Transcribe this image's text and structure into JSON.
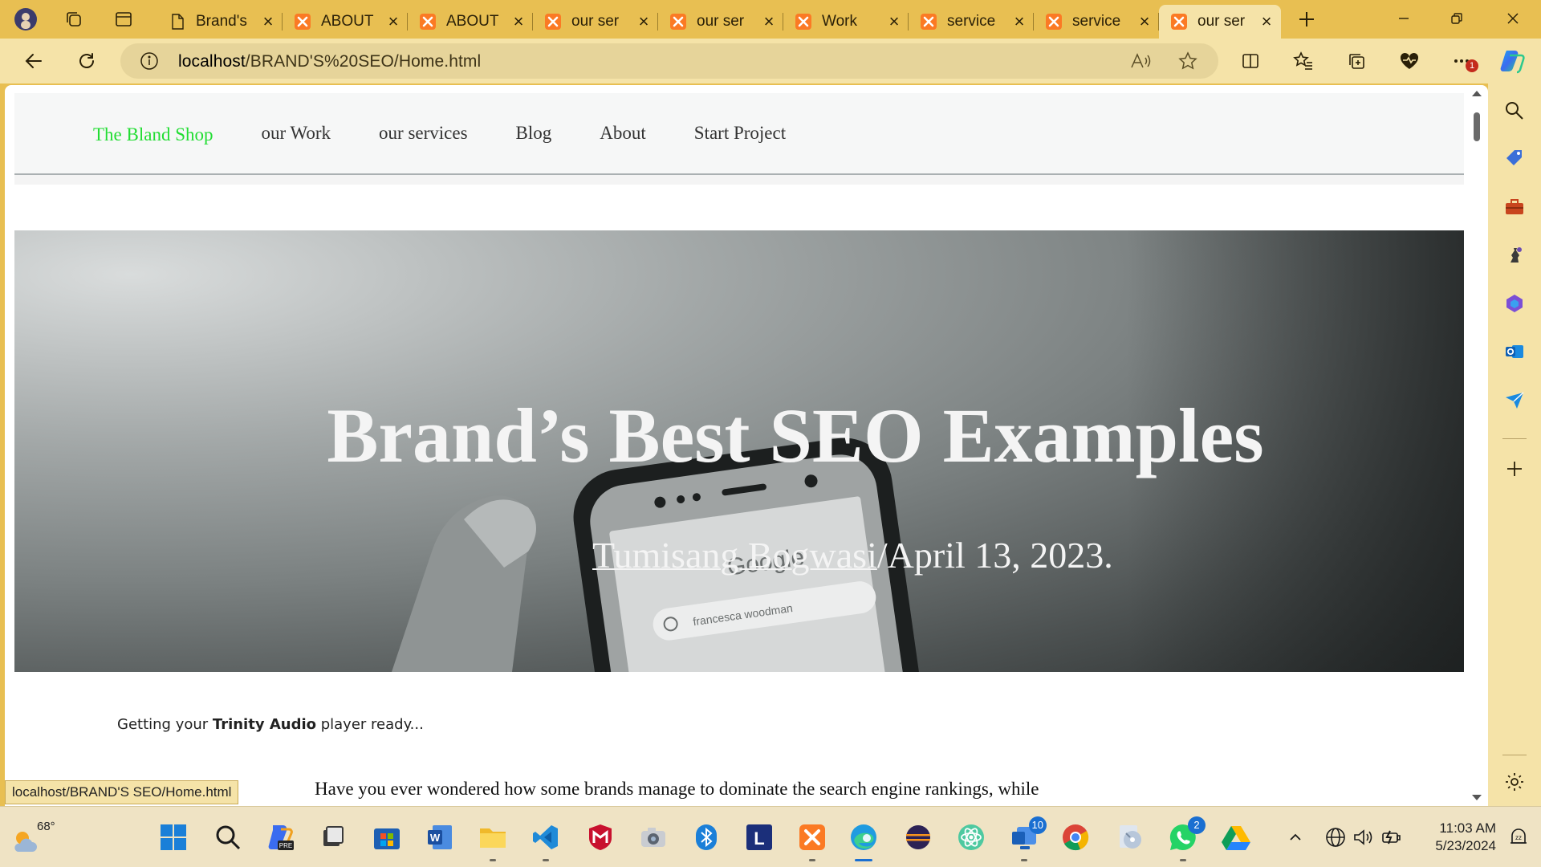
{
  "browser": {
    "tabs": [
      {
        "title": "Brand's",
        "icon": "document-icon",
        "active": false
      },
      {
        "title": "ABOUT",
        "icon": "xampp-icon",
        "active": false
      },
      {
        "title": "ABOUT",
        "icon": "xampp-icon",
        "active": false
      },
      {
        "title": "our ser",
        "icon": "xampp-icon",
        "active": false
      },
      {
        "title": "our ser",
        "icon": "xampp-icon",
        "active": false
      },
      {
        "title": "Work",
        "icon": "xampp-icon",
        "active": false
      },
      {
        "title": "service",
        "icon": "xampp-icon",
        "active": false
      },
      {
        "title": "service",
        "icon": "xampp-icon",
        "active": false
      },
      {
        "title": "our ser",
        "icon": "xampp-icon",
        "active": true
      }
    ],
    "address": {
      "host": "localhost",
      "path": "/BRAND'S%20SEO/Home.html"
    },
    "status_url": "localhost/BRAND'S SEO/Home.html",
    "notification_badge": "1",
    "accent": "#e8bf52"
  },
  "site": {
    "brand": "The Bland Shop",
    "nav": [
      "our Work",
      "our services",
      "Blog",
      "About",
      "Start Project"
    ],
    "hero": {
      "title": "Brand’s Best SEO Examples",
      "author": "Tumisang Bogwasi",
      "date": "/April 13, 2023."
    },
    "audio": {
      "prefix": "Getting your ",
      "name": "Trinity Audio",
      "suffix": " player ready..."
    },
    "intro": "Have you ever wondered how some brands manage to dominate the search engine rankings, while"
  },
  "taskbar": {
    "weather_temp": "68°",
    "apps": [
      {
        "name": "windows-start-icon"
      },
      {
        "name": "search-icon"
      },
      {
        "name": "copilot-pre-icon"
      },
      {
        "name": "task-view-icon"
      },
      {
        "name": "microsoft-store-icon"
      },
      {
        "name": "word-icon"
      },
      {
        "name": "file-explorer-icon"
      },
      {
        "name": "vscode-icon"
      },
      {
        "name": "mcafee-icon"
      },
      {
        "name": "camera-icon"
      },
      {
        "name": "bluetooth-icon"
      },
      {
        "name": "l-app-icon"
      },
      {
        "name": "xampp-icon"
      },
      {
        "name": "edge-icon"
      },
      {
        "name": "eclipse-icon"
      },
      {
        "name": "atom-icon"
      },
      {
        "name": "teams-icon",
        "badge": "10"
      },
      {
        "name": "chrome-icon"
      },
      {
        "name": "disc-icon"
      },
      {
        "name": "whatsapp-icon",
        "badge": "2"
      },
      {
        "name": "google-drive-icon"
      }
    ],
    "time": "11:03 AM",
    "date": "5/23/2024"
  }
}
